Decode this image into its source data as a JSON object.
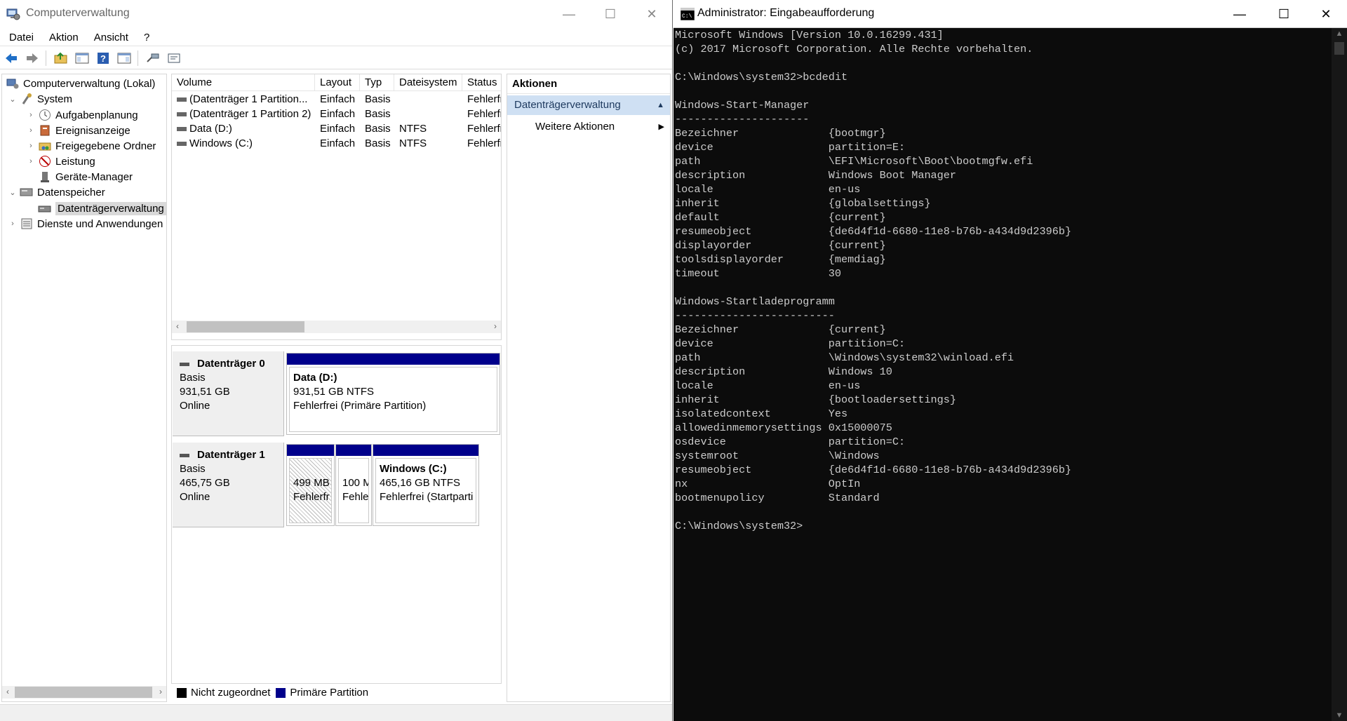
{
  "left_window": {
    "title": "Computerverwaltung",
    "menu": [
      "Datei",
      "Aktion",
      "Ansicht",
      "?"
    ],
    "tree": {
      "root": "Computerverwaltung (Lokal)",
      "system": "System",
      "aufgabenplanung": "Aufgabenplanung",
      "ereignisanzeige": "Ereignisanzeige",
      "freigegebene_ordner": "Freigegebene Ordner",
      "leistung": "Leistung",
      "geraete_manager": "Geräte-Manager",
      "datenspeicher": "Datenspeicher",
      "datentraegerverwaltung": "Datenträgerverwaltung",
      "dienste": "Dienste und Anwendungen"
    },
    "volume_table": {
      "headers": [
        "Volume",
        "Layout",
        "Typ",
        "Dateisystem",
        "Status"
      ],
      "rows": [
        [
          "(Datenträger 1 Partition...",
          "Einfach",
          "Basis",
          "",
          "Fehlerfr"
        ],
        [
          "(Datenträger 1 Partition 2)",
          "Einfach",
          "Basis",
          "",
          "Fehlerfr"
        ],
        [
          "Data (D:)",
          "Einfach",
          "Basis",
          "NTFS",
          "Fehlerfr"
        ],
        [
          "Windows (C:)",
          "Einfach",
          "Basis",
          "NTFS",
          "Fehlerfr"
        ]
      ]
    },
    "disk0": {
      "name": "Datenträger 0",
      "type": "Basis",
      "size": "931,51 GB",
      "status": "Online",
      "partition": {
        "name": "Data  (D:)",
        "size": "931,51 GB NTFS",
        "status": "Fehlerfrei (Primäre Partition)"
      }
    },
    "disk1": {
      "name": "Datenträger 1",
      "type": "Basis",
      "size": "465,75 GB",
      "status": "Online",
      "p1": {
        "size": "499 MB",
        "status": "Fehlerfr"
      },
      "p2": {
        "size": "100 M",
        "status": "Fehle"
      },
      "p3": {
        "name": "Windows  (C:)",
        "size": "465,16 GB NTFS",
        "status": "Fehlerfrei (Startparti"
      }
    },
    "legend": {
      "unallocated": "Nicht zugeordnet",
      "primary": "Primäre Partition",
      "unallocated_color": "#000000",
      "primary_color": "#00008b"
    },
    "actions": {
      "title": "Aktionen",
      "section": "Datenträgerverwaltung",
      "more": "Weitere Aktionen"
    }
  },
  "cmd_window": {
    "title": "Administrator: Eingabeaufforderung",
    "lines": [
      "Microsoft Windows [Version 10.0.16299.431]",
      "(c) 2017 Microsoft Corporation. Alle Rechte vorbehalten.",
      "",
      "C:\\Windows\\system32>bcdedit",
      "",
      "Windows-Start-Manager",
      "---------------------",
      "Bezeichner              {bootmgr}",
      "device                  partition=E:",
      "path                    \\EFI\\Microsoft\\Boot\\bootmgfw.efi",
      "description             Windows Boot Manager",
      "locale                  en-us",
      "inherit                 {globalsettings}",
      "default                 {current}",
      "resumeobject            {de6d4f1d-6680-11e8-b76b-a434d9d2396b}",
      "displayorder            {current}",
      "toolsdisplayorder       {memdiag}",
      "timeout                 30",
      "",
      "Windows-Startladeprogramm",
      "-------------------------",
      "Bezeichner              {current}",
      "device                  partition=C:",
      "path                    \\Windows\\system32\\winload.efi",
      "description             Windows 10",
      "locale                  en-us",
      "inherit                 {bootloadersettings}",
      "isolatedcontext         Yes",
      "allowedinmemorysettings 0x15000075",
      "osdevice                partition=C:",
      "systemroot              \\Windows",
      "resumeobject            {de6d4f1d-6680-11e8-b76b-a434d9d2396b}",
      "nx                      OptIn",
      "bootmenupolicy          Standard",
      "",
      "C:\\Windows\\system32>"
    ]
  }
}
